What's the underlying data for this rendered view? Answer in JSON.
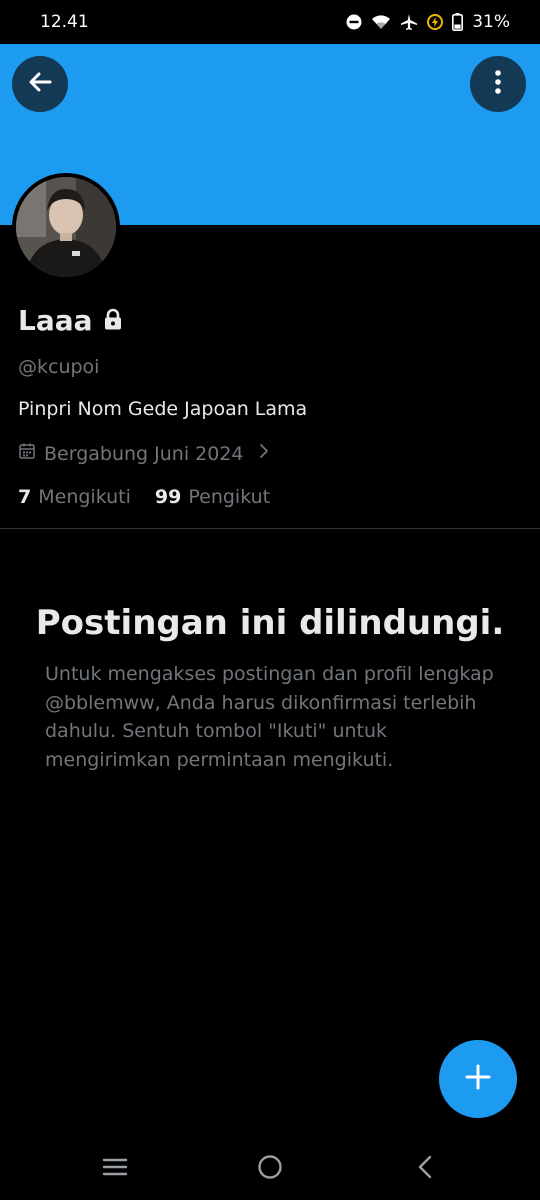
{
  "status_bar": {
    "time": "12.41",
    "battery": "31%",
    "icons": [
      "do-not-disturb-icon",
      "wifi-icon",
      "airplane-icon",
      "battery-saver-icon",
      "battery-icon"
    ]
  },
  "header": {
    "banner_color": "#1d9bf0",
    "back_icon": "arrow-left-icon",
    "more_icon": "more-vertical-icon"
  },
  "profile": {
    "name": "Laaa",
    "protected_icon": "lock-icon",
    "handle": "@kcupoi",
    "bio": "Pinpri Nom Gede Japoan Lama",
    "joined": "Bergabung Juni 2024",
    "following_count": "7",
    "following_label": "Mengikuti",
    "followers_count": "99",
    "followers_label": "Pengikut"
  },
  "protected_notice": {
    "title": "Postingan ini dilindungi.",
    "text": "Untuk mengakses postingan dan profil lengkap @bblemww, Anda harus dikonfirmasi terlebih dahulu. Sentuh tombol \"Ikuti\" untuk mengirimkan permintaan mengikuti."
  },
  "fab": {
    "icon": "plus-icon",
    "color": "#1d9bf0"
  },
  "nav_bar": {
    "icons": [
      "recents-icon",
      "home-icon",
      "back-icon"
    ]
  }
}
